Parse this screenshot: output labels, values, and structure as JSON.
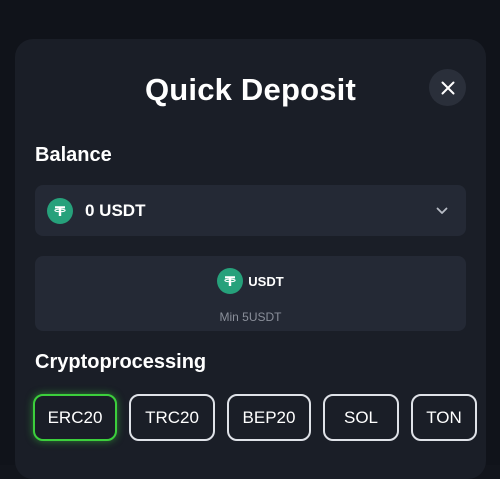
{
  "modal": {
    "title": "Quick Deposit"
  },
  "balance": {
    "label": "Balance",
    "selected_value": "0 USDT",
    "icon": "tether-icon"
  },
  "currency": {
    "name": "USDT",
    "min_text": "Min 5USDT",
    "icon": "tether-icon"
  },
  "cryptoprocessing": {
    "label": "Cryptoprocessing",
    "networks": [
      {
        "label": "ERC20",
        "active": true
      },
      {
        "label": "TRC20",
        "active": false
      },
      {
        "label": "BEP20",
        "active": false
      },
      {
        "label": "SOL",
        "active": false
      },
      {
        "label": "TON",
        "active": false
      }
    ]
  },
  "colors": {
    "accent_active": "#3ccf3c",
    "tether_green": "#26a17b",
    "modal_bg": "#1a1e27",
    "field_bg": "#242935"
  }
}
